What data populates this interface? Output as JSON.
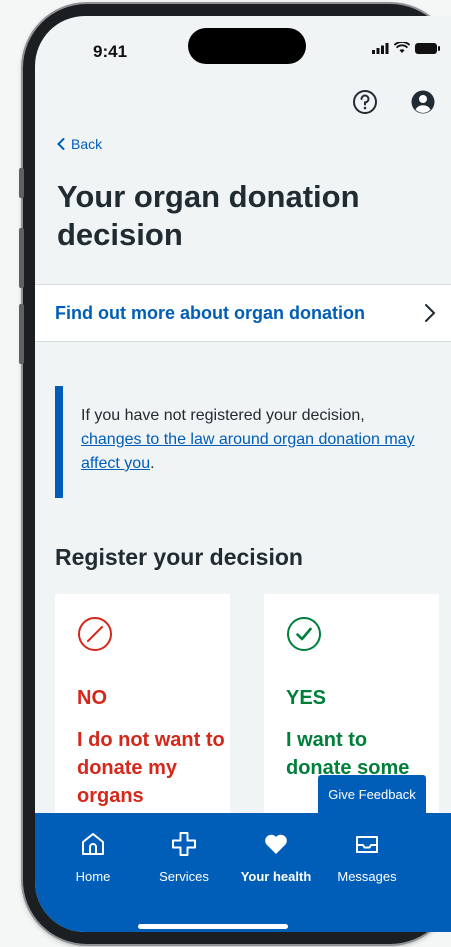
{
  "status_bar": {
    "time": "9:41"
  },
  "header": {
    "help_icon": "help-icon",
    "account_icon": "account-icon"
  },
  "nav": {
    "back_label": "Back"
  },
  "page": {
    "title": "Your organ donation decision",
    "find_more_link": "Find out more about organ donation",
    "inset_text_before": "If you have not registered your decision, ",
    "inset_link": "changes to the law around organ donation may affect you",
    "inset_text_after": ".",
    "section_heading": "Register your decision"
  },
  "cards": [
    {
      "head": "NO",
      "desc": "I do not want to donate my organs",
      "icon": "no-entry-icon",
      "color": "#d5281b"
    },
    {
      "head": "YES",
      "desc": "I want to donate some",
      "icon": "check-circle-icon",
      "color": "#007f3b"
    }
  ],
  "feedback_label": "Give Feedback",
  "tabs": [
    {
      "label": "Home",
      "icon": "home-icon"
    },
    {
      "label": "Services",
      "icon": "cross-icon"
    },
    {
      "label": "Your health",
      "icon": "heart-icon",
      "active": true
    },
    {
      "label": "Messages",
      "icon": "inbox-icon"
    }
  ],
  "colors": {
    "brand_blue": "#005eb8",
    "red": "#d5281b",
    "green": "#007f3b",
    "background": "#f0f4f5"
  }
}
